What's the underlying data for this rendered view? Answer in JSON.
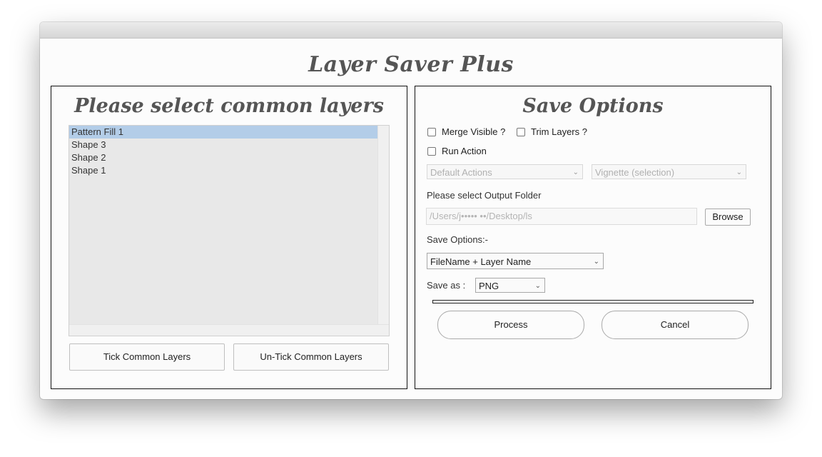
{
  "app": {
    "title": "Layer Saver Plus"
  },
  "left_panel": {
    "heading": "Please select common layers",
    "layers": [
      {
        "label": "Pattern Fill 1",
        "selected": true
      },
      {
        "label": "Shape 3",
        "selected": false
      },
      {
        "label": "Shape 2",
        "selected": false
      },
      {
        "label": "Shape 1",
        "selected": false
      }
    ],
    "tick_button": "Tick Common Layers",
    "untick_button": "Un-Tick Common Layers"
  },
  "right_panel": {
    "heading": "Save Options",
    "merge_visible": {
      "label": "Merge Visible ?",
      "checked": false
    },
    "trim_layers": {
      "label": "Trim Layers ?",
      "checked": false
    },
    "run_action": {
      "label": "Run Action",
      "checked": false
    },
    "action_set": "Default Actions",
    "action_name": "Vignette (selection)",
    "output_folder_label": "Please select Output Folder",
    "output_folder_value": "/Users/j•••••      ••/Desktop/ls",
    "browse_button": "Browse",
    "save_options_label": "Save Options:-",
    "naming_option": "FileName + Layer Name",
    "save_as_label": "Save as :",
    "save_as_format": "PNG",
    "progress": 0,
    "process_button": "Process",
    "cancel_button": "Cancel"
  }
}
